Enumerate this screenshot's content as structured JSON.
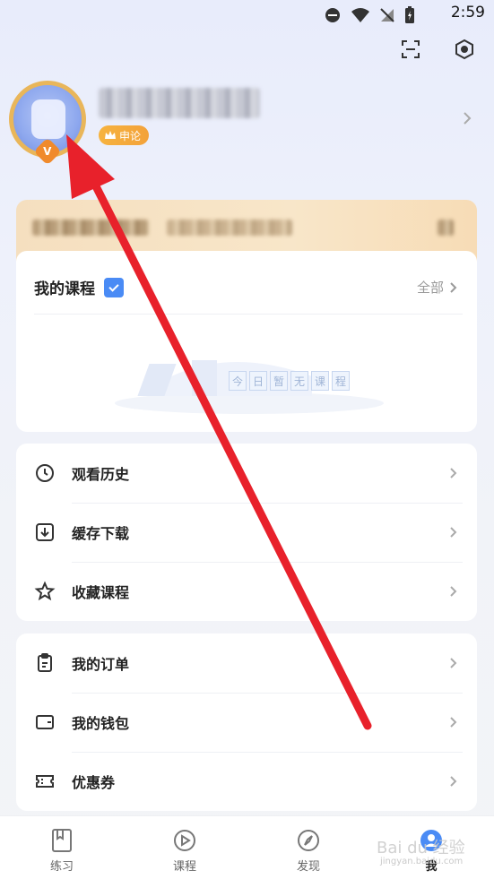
{
  "status_bar": {
    "time": "2:59"
  },
  "profile": {
    "vip_label": "申论"
  },
  "courses": {
    "title": "我的课程",
    "all_label": "全部",
    "empty_chars": [
      "今",
      "日",
      "暂",
      "无",
      "课",
      "程"
    ]
  },
  "menu_group_1": [
    {
      "icon": "clock-icon",
      "label": "观看历史"
    },
    {
      "icon": "download-icon",
      "label": "缓存下载"
    },
    {
      "icon": "star-icon",
      "label": "收藏课程"
    }
  ],
  "menu_group_2": [
    {
      "icon": "clipboard-icon",
      "label": "我的订单"
    },
    {
      "icon": "wallet-icon",
      "label": "我的钱包"
    },
    {
      "icon": "ticket-icon",
      "label": "优惠券"
    }
  ],
  "tabs": [
    {
      "label": "练习",
      "icon": "book-icon"
    },
    {
      "label": "课程",
      "icon": "play-icon"
    },
    {
      "label": "发现",
      "icon": "compass-icon"
    },
    {
      "label": "我",
      "icon": "profile-icon",
      "active": true
    }
  ],
  "watermark": {
    "text": "Bai du 经验",
    "sub": "jingyan.baidu.com"
  },
  "colors": {
    "accent": "#4a8bf5",
    "arrow": "#e8212b",
    "vip": "#f3a23a"
  }
}
